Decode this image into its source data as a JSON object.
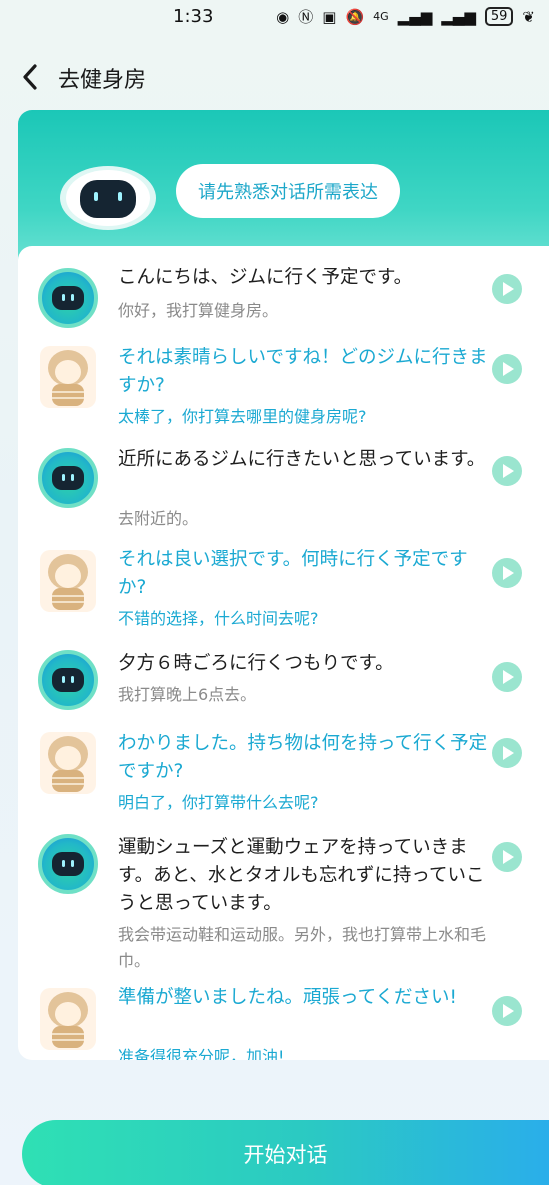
{
  "status_bar": {
    "time": "1:33",
    "battery": "59",
    "network": "4G"
  },
  "nav": {
    "title": "去健身房"
  },
  "header": {
    "intro": "请先熟悉对话所需表达"
  },
  "dialog": [
    {
      "speaker": "bot",
      "jp": "こんにちは、ジムに行く予定です。",
      "zh": "你好，我打算健身房。"
    },
    {
      "speaker": "user",
      "jp": "それは素晴らしいですね！どのジムに行きますか?",
      "zh": "太棒了，你打算去哪里的健身房呢?"
    },
    {
      "speaker": "bot",
      "jp": "近所にあるジムに行きたいと思っています。",
      "zh": "去附近的。"
    },
    {
      "speaker": "user",
      "jp": "それは良い選択です。何時に行く予定ですか?",
      "zh": "不错的选择，什么时间去呢?"
    },
    {
      "speaker": "bot",
      "jp": "夕方６時ごろに行くつもりです。",
      "zh": "我打算晚上6点去。"
    },
    {
      "speaker": "user",
      "jp": "わかりました。持ち物は何を持って行く予定ですか?",
      "zh": "明白了，你打算带什么去呢?"
    },
    {
      "speaker": "bot",
      "jp": "運動シューズと運動ウェアを持っていきます。あと、水とタオルも忘れずに持っていこうと思っています。",
      "zh": "我会带运动鞋和运动服。另外，我也打算带上水和毛巾。"
    },
    {
      "speaker": "user",
      "jp": "準備が整いましたね。頑張ってください!",
      "zh": "准备得很充分呢，加油!"
    }
  ],
  "start_button": "开始对话",
  "colors": {
    "accent": "#1ba9d2",
    "header_teal": "#1bc7b7",
    "play": "#9ae5cf"
  }
}
